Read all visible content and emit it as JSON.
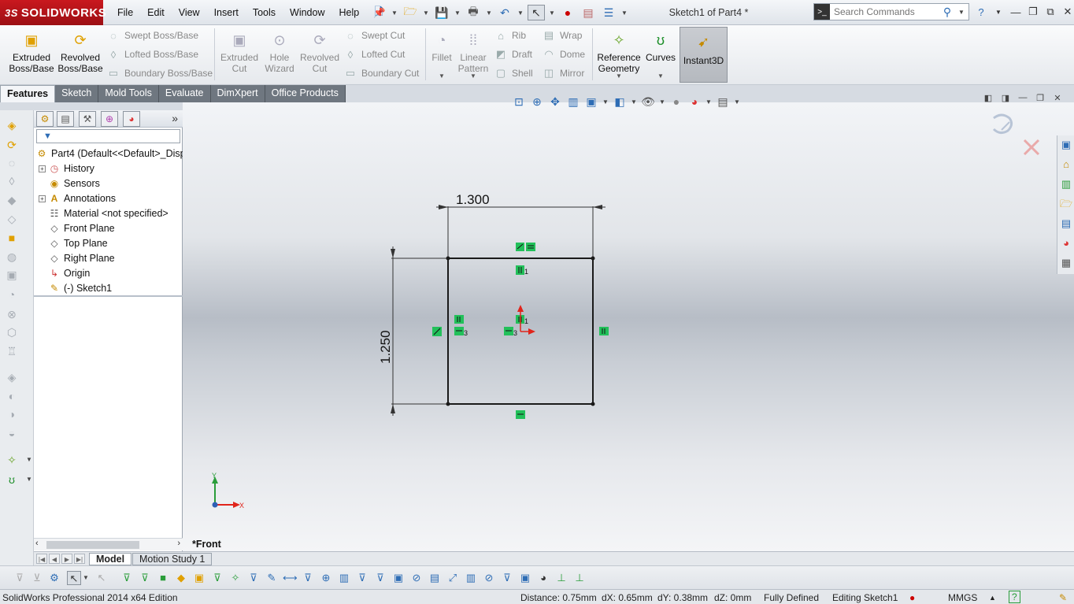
{
  "app": {
    "brand": "SOLIDWORKS",
    "brand_prefix": "3S",
    "document_title": "Sketch1 of Part4 *"
  },
  "menu": [
    "File",
    "Edit",
    "View",
    "Insert",
    "Tools",
    "Window",
    "Help"
  ],
  "search": {
    "placeholder": "Search Commands"
  },
  "command_manager": {
    "extruded_boss": "Extruded\nBoss/Base",
    "revolved_boss": "Revolved\nBoss/Base",
    "swept_boss": "Swept Boss/Base",
    "lofted_boss": "Lofted Boss/Base",
    "boundary_boss": "Boundary Boss/Base",
    "extruded_cut": "Extruded\nCut",
    "hole_wizard": "Hole\nWizard",
    "revolved_cut": "Revolved\nCut",
    "swept_cut": "Swept Cut",
    "lofted_cut": "Lofted Cut",
    "boundary_cut": "Boundary Cut",
    "fillet": "Fillet",
    "linear_pattern": "Linear\nPattern",
    "rib": "Rib",
    "draft": "Draft",
    "shell": "Shell",
    "wrap": "Wrap",
    "dome": "Dome",
    "mirror": "Mirror",
    "reference_geometry": "Reference\nGeometry",
    "curves": "Curves",
    "instant3d": "Instant3D"
  },
  "tabs": [
    "Features",
    "Sketch",
    "Mold Tools",
    "Evaluate",
    "DimXpert",
    "Office Products"
  ],
  "feature_tree": {
    "root": "Part4  (Default<<Default>_Disp",
    "items": [
      {
        "label": "History"
      },
      {
        "label": "Sensors"
      },
      {
        "label": "Annotations"
      },
      {
        "label": "Material <not specified>"
      },
      {
        "label": "Front Plane"
      },
      {
        "label": "Top Plane"
      },
      {
        "label": "Right Plane"
      },
      {
        "label": "Origin"
      },
      {
        "label": "(-) Sketch1"
      }
    ]
  },
  "sketch": {
    "dim_width": "1.300",
    "dim_height": "1.250",
    "relation_label": "3",
    "relation_label_1": "1"
  },
  "triad": {
    "x": "X",
    "y": "Y"
  },
  "view_label": "*Front",
  "model_tabs": [
    "Model",
    "Motion Study 1"
  ],
  "status": {
    "edition": "SolidWorks Professional 2014 x64 Edition",
    "distance": "Distance: 0.75mm",
    "dx": "dX: 0.65mm",
    "dy": "dY: 0.38mm",
    "dz": "dZ: 0mm",
    "state": "Fully Defined",
    "editing": "Editing Sketch1",
    "units": "MMGS"
  },
  "colors": {
    "brand_red": "#c9181e",
    "relation_green": "#22c05a",
    "sketch_line": "#1a1a1a",
    "triad_x": "#e0241b",
    "triad_y": "#2a9d3a"
  }
}
